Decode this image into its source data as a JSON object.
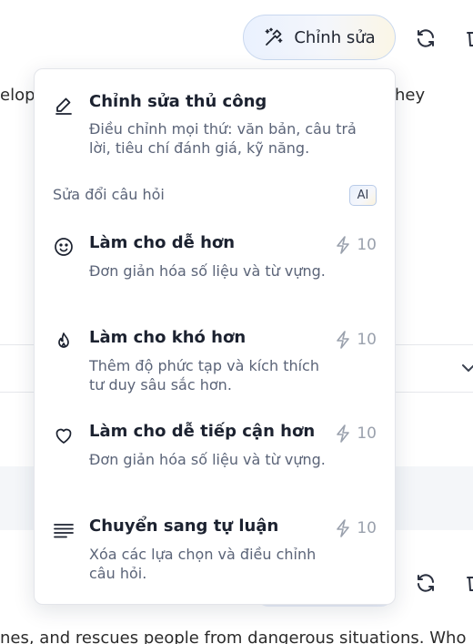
{
  "toolbar": {
    "edit_label": "Chỉnh sửa"
  },
  "background": {
    "text_left": "elop",
    "text_right": "hey",
    "bottom_text": "nes, and rescues people from dangerous situations. Who"
  },
  "menu": {
    "manual": {
      "title": "Chỉnh sửa thủ công",
      "desc": "Điều chỉnh mọi thứ: văn bản, câu trả lời, tiêu chí đánh giá, kỹ năng."
    },
    "section_label": "Sửa đổi câu hỏi",
    "ai_badge": "AI",
    "items": [
      {
        "title": "Làm cho dễ hơn",
        "desc": "Đơn giản hóa số liệu và từ vựng.",
        "cost": "10",
        "icon": "smiley-icon"
      },
      {
        "title": "Làm cho khó hơn",
        "desc": "Thêm độ phức tạp và kích thích tư duy sâu sắc hơn.",
        "cost": "10",
        "icon": "flame-icon"
      },
      {
        "title": "Làm cho dễ tiếp cận hơn",
        "desc": "Đơn giản hóa số liệu và từ vựng.",
        "cost": "10",
        "icon": "heart-icon"
      },
      {
        "title": "Chuyển sang tự luận",
        "desc": "Xóa các lựa chọn và điều chỉnh câu hỏi.",
        "cost": "10",
        "icon": "text-lines-icon"
      }
    ]
  },
  "colors": {
    "accent_border": "#c9d8ef",
    "text_primary": "#1c2230",
    "text_secondary": "#5b6478",
    "cost_gray": "#9aa1ad"
  }
}
